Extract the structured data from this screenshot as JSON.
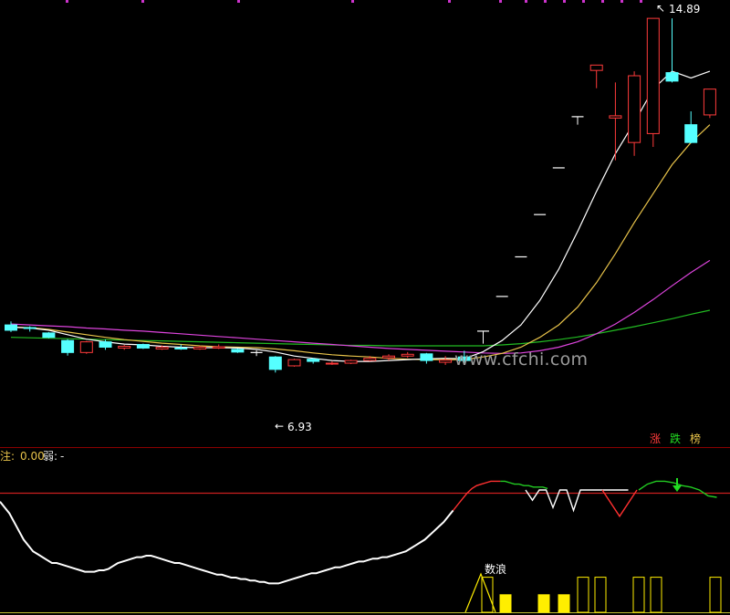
{
  "chart_data": [
    {
      "type": "candlestick",
      "title": "",
      "ylim": [
        5.5,
        15.2
      ],
      "high_label": "14.89",
      "low_label": "6.93",
      "legend": [
        "涨",
        "跌",
        "榜"
      ],
      "colors": {
        "up": "#ff3b3b",
        "down": "#55ffff",
        "ma5": "#ffffff",
        "ma10": "#e8c34a",
        "ma20": "#dd44dd",
        "ma60": "#22bb22"
      },
      "candles": [
        {
          "o": 8.0,
          "c": 7.88,
          "h": 8.08,
          "l": 7.84
        },
        {
          "o": 7.94,
          "c": 7.92,
          "h": 7.97,
          "l": 7.85
        },
        {
          "o": 7.82,
          "c": 7.72,
          "h": 7.84,
          "l": 7.7
        },
        {
          "o": 7.65,
          "c": 7.38,
          "h": 7.68,
          "l": 7.31
        },
        {
          "o": 7.38,
          "c": 7.62,
          "h": 7.64,
          "l": 7.35
        },
        {
          "o": 7.62,
          "c": 7.5,
          "h": 7.67,
          "l": 7.44
        },
        {
          "o": 7.48,
          "c": 7.52,
          "h": 7.55,
          "l": 7.44
        },
        {
          "o": 7.56,
          "c": 7.48,
          "h": 7.58,
          "l": 7.46
        },
        {
          "o": 7.46,
          "c": 7.5,
          "h": 7.54,
          "l": 7.44
        },
        {
          "o": 7.48,
          "c": 7.47,
          "h": 7.56,
          "l": 7.44
        },
        {
          "o": 7.46,
          "c": 7.5,
          "h": 7.53,
          "l": 7.44
        },
        {
          "o": 7.48,
          "c": 7.51,
          "h": 7.56,
          "l": 7.46
        },
        {
          "o": 7.45,
          "c": 7.39,
          "h": 7.47,
          "l": 7.37
        },
        {
          "o": 7.38,
          "c": 7.38,
          "h": 7.43,
          "l": 7.3
        },
        {
          "o": 7.28,
          "c": 7.0,
          "h": 7.3,
          "l": 6.93
        },
        {
          "o": 7.08,
          "c": 7.22,
          "h": 7.24,
          "l": 7.06
        },
        {
          "o": 7.23,
          "c": 7.18,
          "h": 7.26,
          "l": 7.13
        },
        {
          "o": 7.12,
          "c": 7.14,
          "h": 7.18,
          "l": 7.1
        },
        {
          "o": 7.14,
          "c": 7.2,
          "h": 7.22,
          "l": 7.12
        },
        {
          "o": 7.2,
          "c": 7.25,
          "h": 7.3,
          "l": 7.18
        },
        {
          "o": 7.26,
          "c": 7.3,
          "h": 7.34,
          "l": 7.2
        },
        {
          "o": 7.3,
          "c": 7.34,
          "h": 7.39,
          "l": 7.26
        },
        {
          "o": 7.35,
          "c": 7.2,
          "h": 7.37,
          "l": 7.13
        },
        {
          "o": 7.16,
          "c": 7.21,
          "h": 7.3,
          "l": 7.1
        },
        {
          "o": 7.28,
          "c": 7.2,
          "h": 7.42,
          "l": 7.14
        },
        {
          "o": 7.86,
          "c": 7.86,
          "h": 7.86,
          "l": 7.58
        },
        {
          "o": 8.64,
          "c": 8.64,
          "h": 8.64,
          "l": 8.64
        },
        {
          "o": 9.53,
          "c": 9.53,
          "h": 9.53,
          "l": 9.53
        },
        {
          "o": 10.48,
          "c": 10.48,
          "h": 10.48,
          "l": 10.48
        },
        {
          "o": 11.53,
          "c": 11.53,
          "h": 11.53,
          "l": 11.53
        },
        {
          "o": 12.68,
          "c": 12.68,
          "h": 12.68,
          "l": 12.5
        },
        {
          "o": 13.72,
          "c": 13.84,
          "h": 13.84,
          "l": 13.32
        },
        {
          "o": 12.65,
          "c": 12.7,
          "h": 13.45,
          "l": 11.7
        },
        {
          "o": 12.1,
          "c": 13.6,
          "h": 13.7,
          "l": 11.8
        },
        {
          "o": 12.3,
          "c": 14.89,
          "h": 14.89,
          "l": 12.0
        },
        {
          "o": 13.67,
          "c": 13.48,
          "h": 14.89,
          "l": 13.45
        },
        {
          "o": 12.5,
          "c": 12.1,
          "h": 12.8,
          "l": 12.08
        },
        {
          "o": 12.72,
          "c": 13.3,
          "h": 13.3,
          "l": 12.65
        }
      ],
      "ma5": [
        7.95,
        7.93,
        7.88,
        7.78,
        7.68,
        7.62,
        7.57,
        7.55,
        7.52,
        7.5,
        7.49,
        7.49,
        7.48,
        7.45,
        7.39,
        7.3,
        7.25,
        7.2,
        7.18,
        7.18,
        7.2,
        7.22,
        7.24,
        7.25,
        7.24,
        7.4,
        7.65,
        8.0,
        8.55,
        9.25,
        10.1,
        11.0,
        11.85,
        12.55,
        13.3,
        13.7,
        13.55,
        13.7
      ],
      "ma10": [
        7.95,
        7.94,
        7.9,
        7.84,
        7.78,
        7.72,
        7.67,
        7.63,
        7.59,
        7.56,
        7.53,
        7.51,
        7.5,
        7.49,
        7.46,
        7.42,
        7.37,
        7.33,
        7.3,
        7.28,
        7.25,
        7.23,
        7.22,
        7.22,
        7.22,
        7.28,
        7.36,
        7.5,
        7.72,
        8.0,
        8.4,
        8.95,
        9.6,
        10.3,
        10.95,
        11.6,
        12.1,
        12.5
      ],
      "ma20": [
        8.02,
        8.0,
        7.98,
        7.96,
        7.93,
        7.91,
        7.88,
        7.86,
        7.83,
        7.8,
        7.77,
        7.74,
        7.71,
        7.68,
        7.65,
        7.62,
        7.59,
        7.56,
        7.53,
        7.5,
        7.47,
        7.45,
        7.43,
        7.41,
        7.39,
        7.37,
        7.36,
        7.37,
        7.42,
        7.5,
        7.62,
        7.8,
        8.02,
        8.28,
        8.57,
        8.88,
        9.18,
        9.45
      ],
      "ma60": [
        7.72,
        7.71,
        7.7,
        7.69,
        7.68,
        7.67,
        7.66,
        7.65,
        7.64,
        7.63,
        7.62,
        7.61,
        7.6,
        7.59,
        7.58,
        7.57,
        7.56,
        7.55,
        7.54,
        7.54,
        7.53,
        7.53,
        7.53,
        7.53,
        7.53,
        7.53,
        7.55,
        7.58,
        7.62,
        7.67,
        7.73,
        7.8,
        7.88,
        7.96,
        8.05,
        8.14,
        8.24,
        8.33
      ]
    },
    {
      "type": "indicator",
      "header_label": "注:",
      "header_value": "0.00",
      "weak_label": "弱:",
      "weak_value": "-",
      "annotation": "数浪",
      "ylim": [
        0,
        100
      ],
      "threshold": 80,
      "colors": {
        "baseline": "#ff3030",
        "main_low": "#ffffff",
        "main_rise": "#ff3030",
        "main_high": "#22cc22",
        "bar": "#ffee00"
      },
      "main_line": [
        72,
        68,
        64,
        58,
        52,
        46,
        42,
        38,
        36,
        34,
        32,
        30,
        30,
        29,
        28,
        27,
        26,
        25,
        24,
        24,
        24,
        25,
        25,
        26,
        28,
        30,
        31,
        32,
        33,
        34,
        34,
        35,
        35,
        34,
        33,
        32,
        31,
        30,
        30,
        29,
        28,
        27,
        26,
        25,
        24,
        23,
        22,
        22,
        21,
        20,
        20,
        19,
        19,
        18,
        18,
        17,
        17,
        16,
        16,
        16,
        17,
        18,
        19,
        20,
        21,
        22,
        23,
        23,
        24,
        25,
        26,
        27,
        27,
        28,
        29,
        30,
        31,
        31,
        32,
        33,
        33,
        34,
        34,
        35,
        36,
        37,
        38,
        40,
        42,
        44,
        46,
        49,
        52,
        55,
        58,
        62,
        66,
        70,
        74,
        78,
        81,
        83,
        84,
        85,
        86,
        86,
        86,
        86,
        85,
        84,
        84,
        83,
        83,
        82,
        82,
        82,
        81
      ],
      "white_zigzag": [
        80,
        73,
        80,
        80,
        68,
        80,
        80,
        66,
        80,
        80,
        80,
        80,
        80,
        80,
        80,
        80
      ],
      "red_valleys": [
        80,
        62,
        80
      ],
      "green_tail": [
        80,
        84,
        86,
        86,
        85,
        83,
        82,
        80,
        76,
        75
      ],
      "bars": [
        {
          "v": 20,
          "fill": false
        },
        {
          "v": 10,
          "fill": true
        },
        {
          "v": 10,
          "fill": true
        },
        {
          "v": 10,
          "fill": true
        },
        {
          "v": 20,
          "fill": false
        },
        {
          "v": 20,
          "fill": false
        },
        {
          "v": 20,
          "fill": false
        },
        {
          "v": 20,
          "fill": false
        },
        {
          "v": 20,
          "fill": false
        }
      ]
    }
  ],
  "watermark": "www.cfchi.com"
}
